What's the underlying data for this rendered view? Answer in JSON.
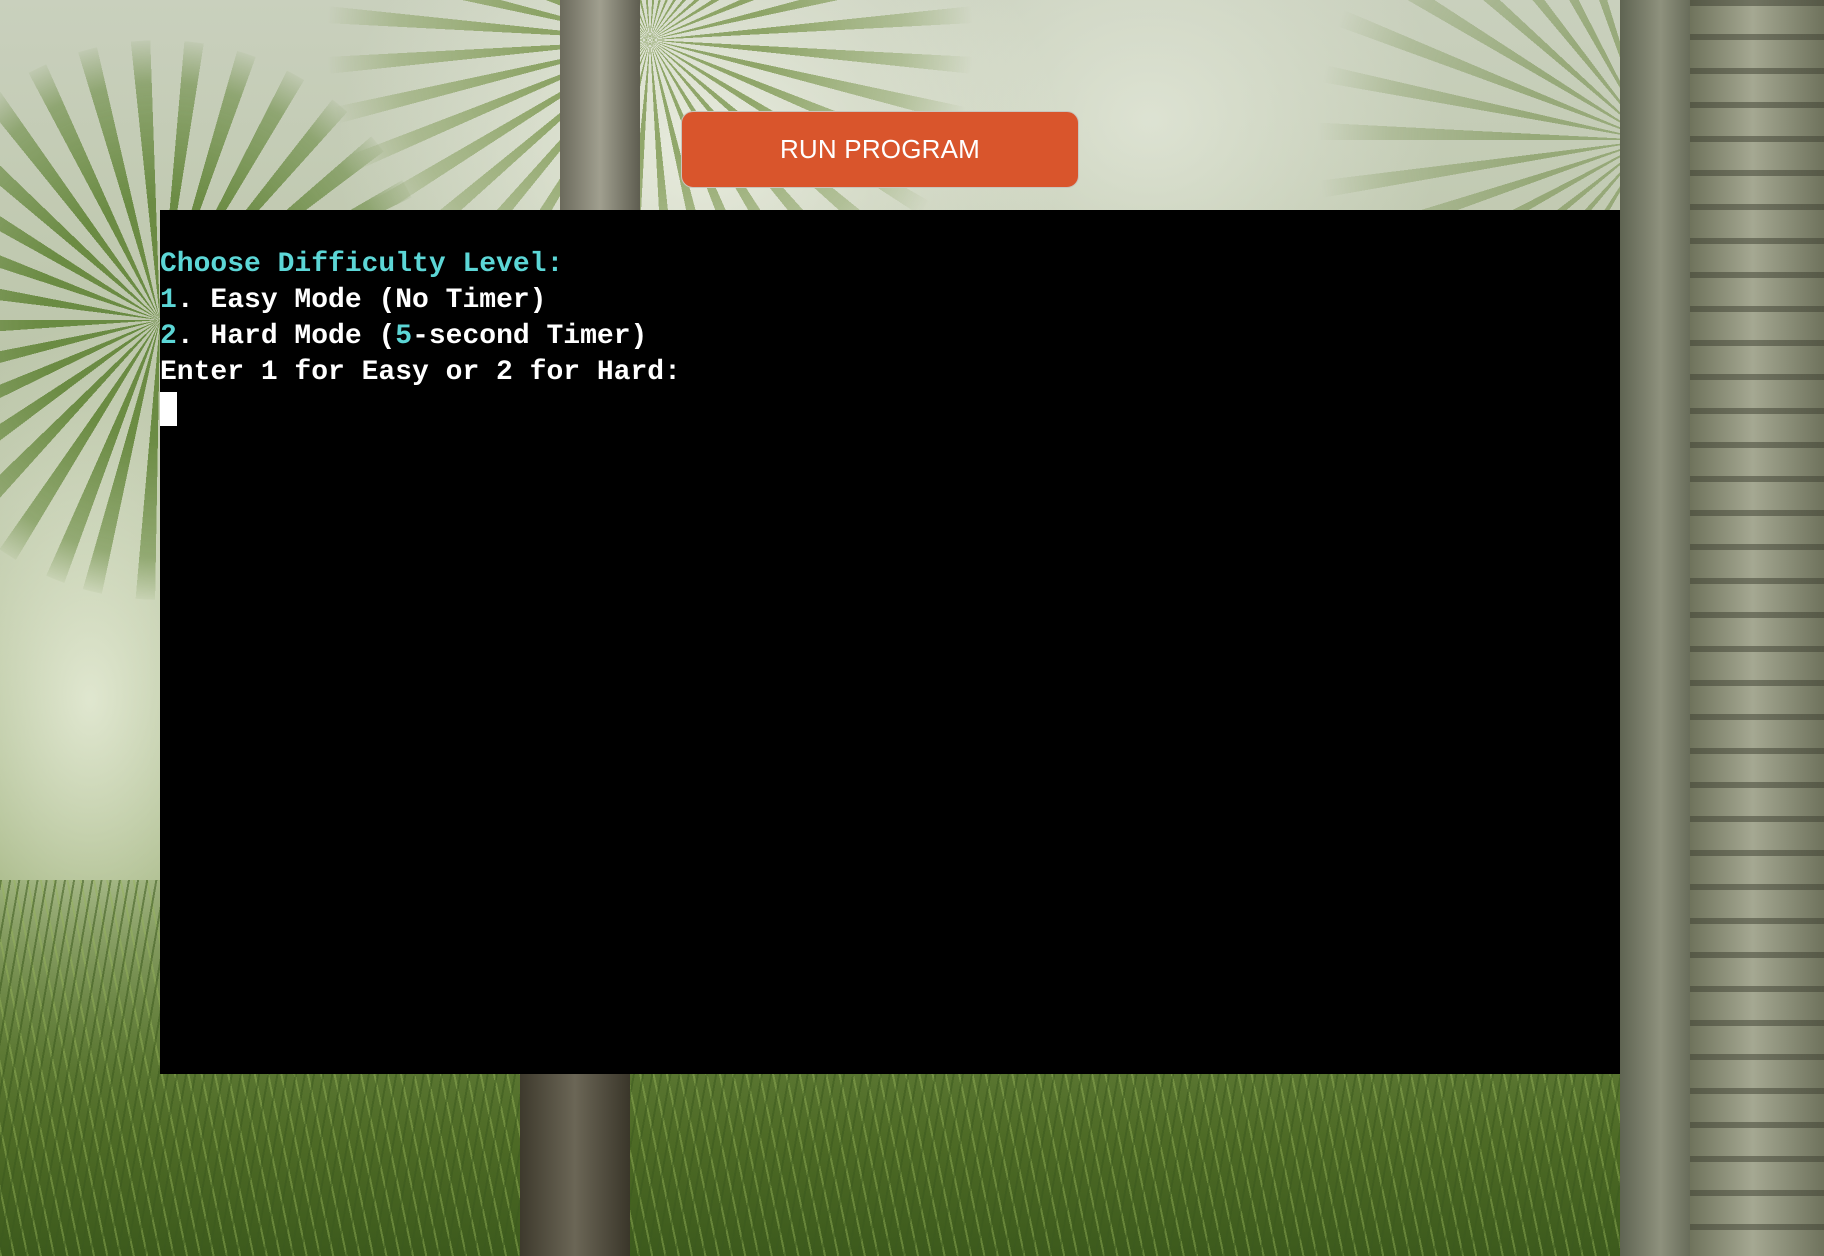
{
  "run_button": {
    "label": "RUN PROGRAM"
  },
  "terminal": {
    "heading": "Choose Difficulty Level:",
    "options": [
      {
        "number": "1",
        "text_before": ". Easy Mode (No Timer)",
        "highlight": "",
        "text_after": ""
      },
      {
        "number": "2",
        "text_before": ". Hard Mode (",
        "highlight": "5",
        "text_after": "-second Timer)"
      }
    ],
    "prompt": "Enter 1 for Easy or 2 for Hard:",
    "input_value": ""
  },
  "colors": {
    "button_background": "#d9552c",
    "terminal_background": "#000000",
    "terminal_text": "#ffffff",
    "terminal_accent": "#5cd6d6"
  },
  "icons": {
    "background": "jungle-background-image"
  }
}
